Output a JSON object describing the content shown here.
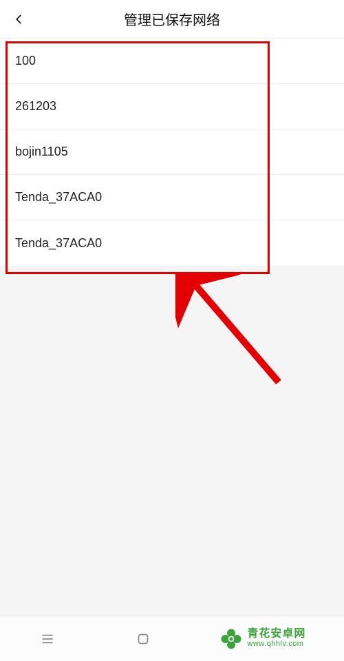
{
  "header": {
    "title": "管理已保存网络"
  },
  "networks": [
    {
      "ssid": "100"
    },
    {
      "ssid": "261203"
    },
    {
      "ssid": "bojin1105"
    },
    {
      "ssid": "Tenda_37ACA0"
    },
    {
      "ssid": "Tenda_37ACA0"
    }
  ],
  "watermark": {
    "line1": "青花安卓网",
    "line2": "www.qhhlv.com"
  }
}
